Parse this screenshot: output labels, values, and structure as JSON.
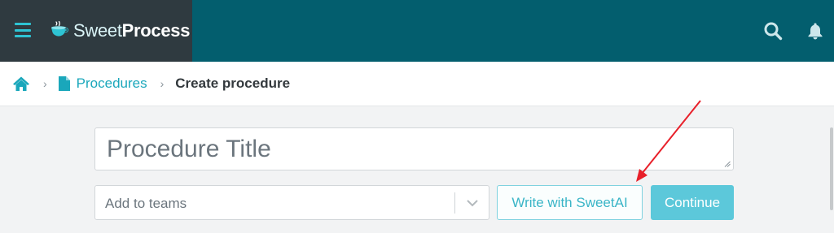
{
  "header": {
    "logo_light": "Sweet",
    "logo_bold": "Process",
    "colors": {
      "topbar": "#035e6e",
      "brand_panel": "#2f3a40",
      "accent": "#2ec4d4"
    },
    "icons": [
      "hamburger-icon",
      "logo-cup-icon",
      "search-icon",
      "bell-icon"
    ]
  },
  "breadcrumb": {
    "icons": [
      "home-icon",
      "document-icon"
    ],
    "procedures_label": "Procedures",
    "current_label": "Create procedure"
  },
  "form": {
    "title_placeholder": "Procedure Title",
    "title_value": "",
    "teams_placeholder": "Add to teams",
    "sweetai_label": "Write with SweetAI",
    "continue_label": "Continue",
    "colors": {
      "link": "#1aa7bb",
      "continue_bg": "#5cc8da",
      "sweetai_border": "#7fd2df",
      "annotation_arrow": "#e8202a"
    }
  }
}
